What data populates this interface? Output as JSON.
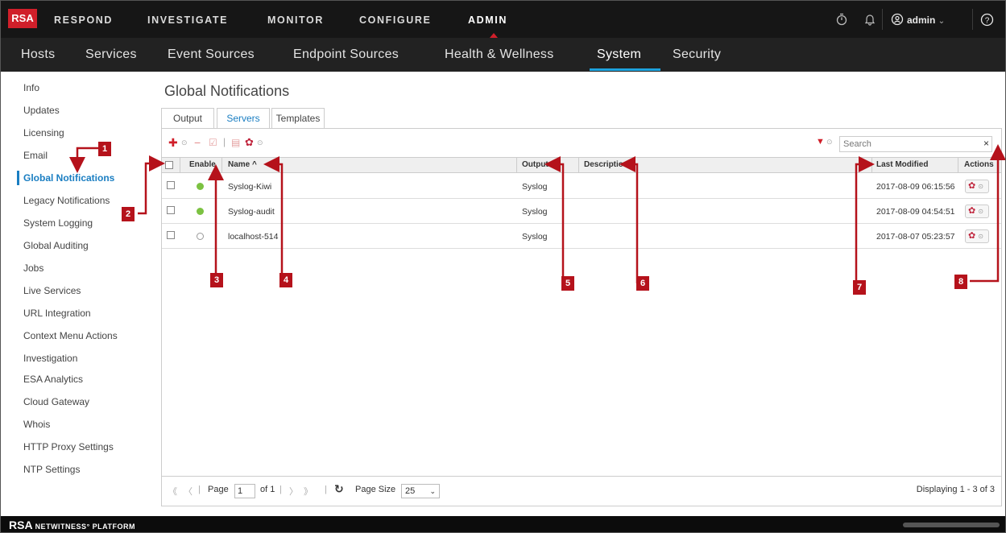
{
  "topnav": {
    "logo": "RSA",
    "items": [
      "RESPOND",
      "INVESTIGATE",
      "MONITOR",
      "CONFIGURE",
      "ADMIN"
    ],
    "active": "ADMIN",
    "user": "admin",
    "icons": [
      "timer-icon",
      "bell-icon",
      "user-icon",
      "help-icon"
    ]
  },
  "subnav": {
    "items": [
      "Hosts",
      "Services",
      "Event Sources",
      "Endpoint Sources",
      "Health & Wellness",
      "System",
      "Security"
    ],
    "active": "System"
  },
  "sidebar": {
    "items": [
      "Info",
      "Updates",
      "Licensing",
      "Email",
      "Global Notifications",
      "Legacy Notifications",
      "System Logging",
      "Global Auditing",
      "Jobs",
      "Live Services",
      "URL Integration",
      "Context Menu Actions",
      "Investigation",
      "ESA Analytics",
      "Cloud Gateway",
      "Whois",
      "HTTP Proxy Settings",
      "NTP Settings"
    ],
    "active": "Global Notifications"
  },
  "main": {
    "title": "Global Notifications",
    "tabs": [
      "Output",
      "Servers",
      "Templates"
    ],
    "active_tab": "Servers",
    "search_placeholder": "Search",
    "search_clear": "×"
  },
  "table": {
    "headers": [
      "Enable",
      "Name ^",
      "Output",
      "Description",
      "Last Modified",
      "Actions"
    ],
    "rows": [
      {
        "enabled": true,
        "name": "Syslog-Kiwi",
        "output": "Syslog",
        "description": "",
        "modified": "2017-08-09 06:15:56"
      },
      {
        "enabled": true,
        "name": "Syslog-audit",
        "output": "Syslog",
        "description": "",
        "modified": "2017-08-09 04:54:51"
      },
      {
        "enabled": false,
        "name": "localhost-514",
        "output": "Syslog",
        "description": "",
        "modified": "2017-08-07 05:23:57"
      }
    ]
  },
  "pager": {
    "page_label": "Page",
    "page_value": "1",
    "of_label": "of 1",
    "page_size_label": "Page Size",
    "page_size": "25",
    "displaying": "Displaying 1 - 3 of 3"
  },
  "footer": {
    "brand": "RSA",
    "product": "NETWITNESS° PLATFORM"
  },
  "callouts": [
    "1",
    "2",
    "3",
    "4",
    "5",
    "6",
    "7",
    "8"
  ],
  "colors": {
    "accent_red": "#d01f2a",
    "accent_blue": "#1a7ec2",
    "enabled_green": "#7cc242"
  }
}
